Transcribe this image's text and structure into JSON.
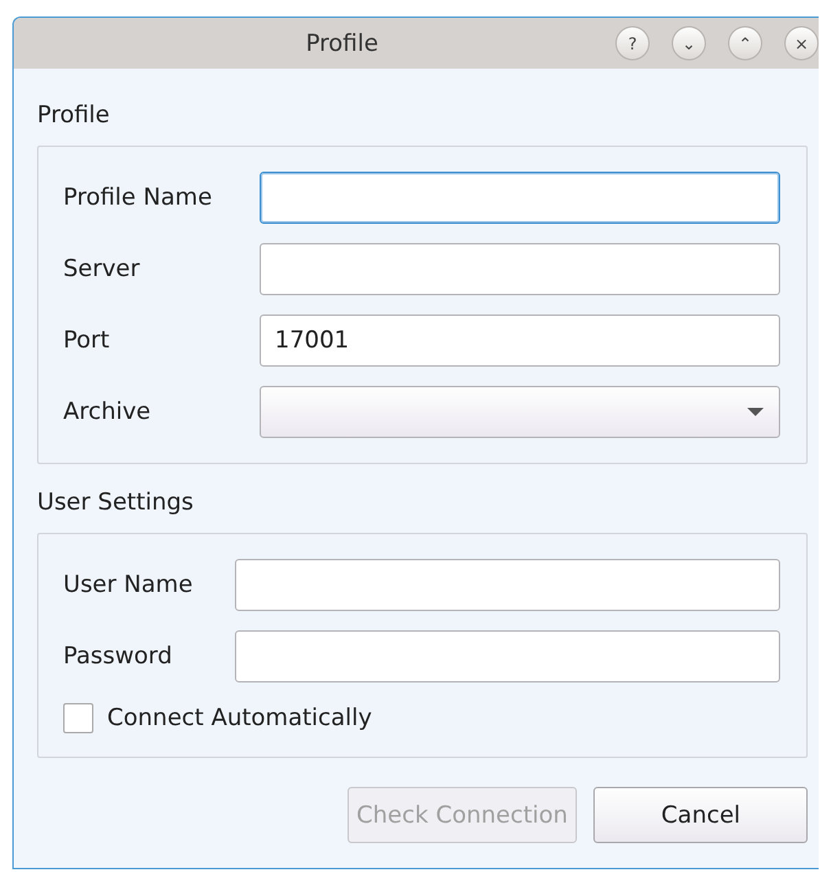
{
  "window": {
    "title": "Profile",
    "title_buttons": [
      "?",
      "⌄",
      "⌃",
      "×"
    ]
  },
  "groups": [
    {
      "title": "Profile",
      "fields": [
        {
          "label": "Profile Name",
          "kind": "text",
          "focused": true
        },
        {
          "label": "Server",
          "kind": "text",
          "focused": false
        },
        {
          "label": "Port",
          "kind": "text",
          "value": "17001",
          "focused": false
        },
        {
          "label": "Archive",
          "kind": "combo",
          "focused": false
        }
      ]
    },
    {
      "title": "User Settings",
      "fields": [
        {
          "label": "User Name",
          "kind": "text",
          "focused": false
        },
        {
          "label": "Password",
          "kind": "password",
          "focused": false
        }
      ],
      "checkbox": {
        "label": "Connect Automatically",
        "checked": false
      }
    }
  ],
  "buttons": [
    {
      "label": "Check Connection",
      "disabled": true
    },
    {
      "label": "Cancel",
      "disabled": false
    }
  ]
}
